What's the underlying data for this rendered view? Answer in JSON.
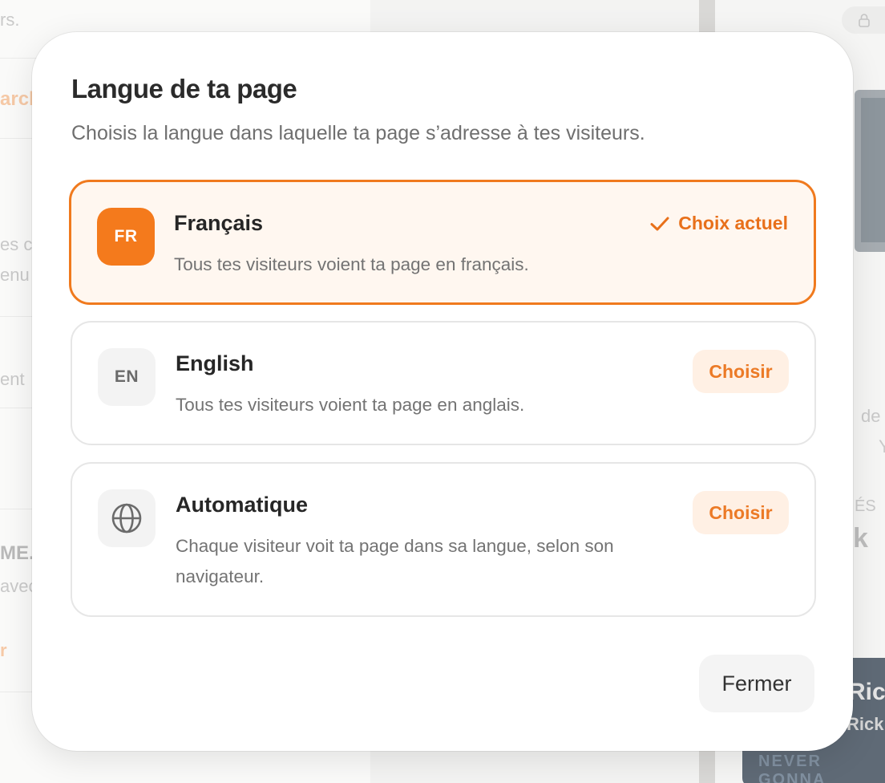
{
  "background": {
    "fragments": [
      "rs.",
      "arch",
      "es c",
      "enu",
      "ent",
      "ME.",
      "avec",
      "r",
      "de",
      "Y",
      "ÉS",
      "k",
      "Ric",
      "Rick",
      "NEVER GONNA"
    ]
  },
  "modal": {
    "title": "Langue de ta page",
    "subtitle": "Choisis la langue dans laquelle ta page s’adresse à tes visiteurs.",
    "options": [
      {
        "code": "FR",
        "name": "Français",
        "description": "Tous tes visiteurs voient ta page en français.",
        "status": "Choix actuel",
        "selected": true
      },
      {
        "code": "EN",
        "name": "English",
        "description": "Tous tes visiteurs voient ta page en anglais.",
        "action": "Choisir",
        "selected": false
      },
      {
        "icon": "globe-icon",
        "name": "Automatique",
        "description": "Chaque visiteur voit ta page dans sa langue, selon son navigateur.",
        "action": "Choisir",
        "selected": false
      }
    ],
    "close_label": "Fermer"
  },
  "colors": {
    "accent": "#f47a1c",
    "accent_soft": "#fff0e4",
    "selected_bg": "#fff7f0",
    "text_primary": "#262626",
    "text_secondary": "#737373"
  }
}
